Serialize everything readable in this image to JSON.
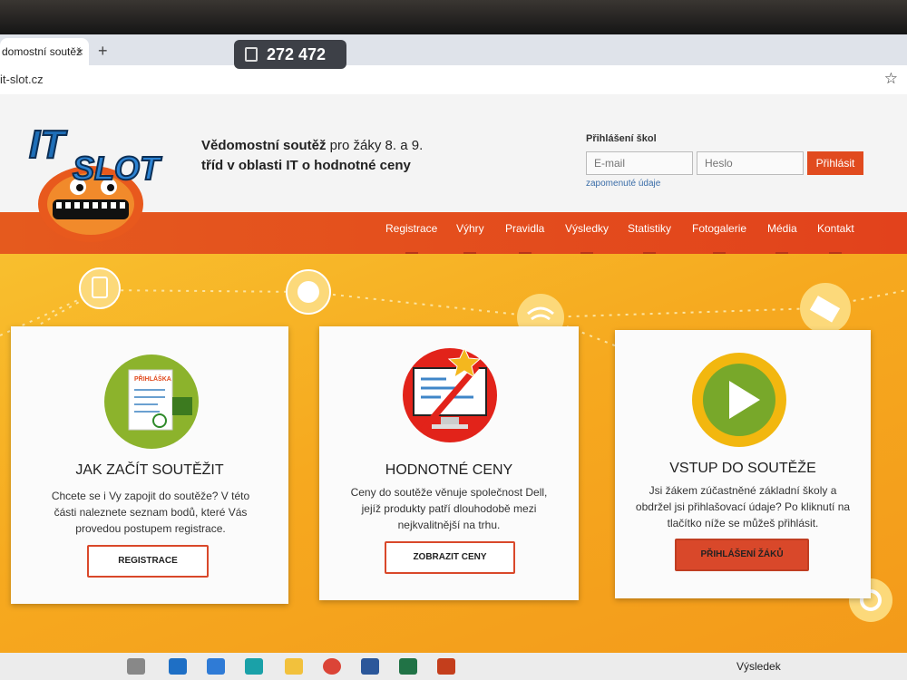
{
  "counter": {
    "value": "272 472"
  },
  "browser": {
    "tab_title": "domostní soutěž",
    "tab_close": "×",
    "new_tab": "+",
    "url": "it-slot.cz",
    "bookmark": "☆"
  },
  "header": {
    "logo_text": "IT SLOT",
    "tagline_bold1": "Vědomostní soutěž",
    "tagline_mid": " pro žáky 8. a 9.",
    "tagline_bold2": "tříd v oblasti IT o hodnotné ceny"
  },
  "login": {
    "title": "Přihlášení škol",
    "email_placeholder": "E-mail",
    "password_placeholder": "Heslo",
    "button": "Přihlásit",
    "forgot": "zapomenuté údaje"
  },
  "nav": [
    "Registrace",
    "Výhry",
    "Pravidla",
    "Výsledky",
    "Statistiky",
    "Fotogalerie",
    "Média",
    "Kontakt"
  ],
  "cards": [
    {
      "badge": "PŘIHLÁŠKA",
      "title": "JAK ZAČÍT SOUTĚŽIT",
      "text": "Chcete se i Vy zapojit do soutěže? V této části naleznete seznam bodů, které Vás provedou postupem registrace.",
      "button": "REGISTRACE"
    },
    {
      "title": "HODNOTNÉ CENY",
      "text": "Ceny do soutěže věnuje společnost Dell, jejíž produkty patří dlouhodobě mezi nejkvalitnější na trhu.",
      "button": "ZOBRAZIT CENY"
    },
    {
      "title": "VSTUP DO SOUTĚŽE",
      "text": "Jsi žákem zúčastněné základní školy a obdržel jsi přihlašovací údaje? Po kliknutí na tlačítko níže se můžeš přihlásit.",
      "button": "PŘIHLÁŠENÍ ŽÁKŮ"
    }
  ],
  "taskbar": {
    "weather": "Výsledek"
  },
  "colors": {
    "accent": "#e14b1f",
    "hero": "#f6a91f",
    "link": "#3a6da8"
  }
}
